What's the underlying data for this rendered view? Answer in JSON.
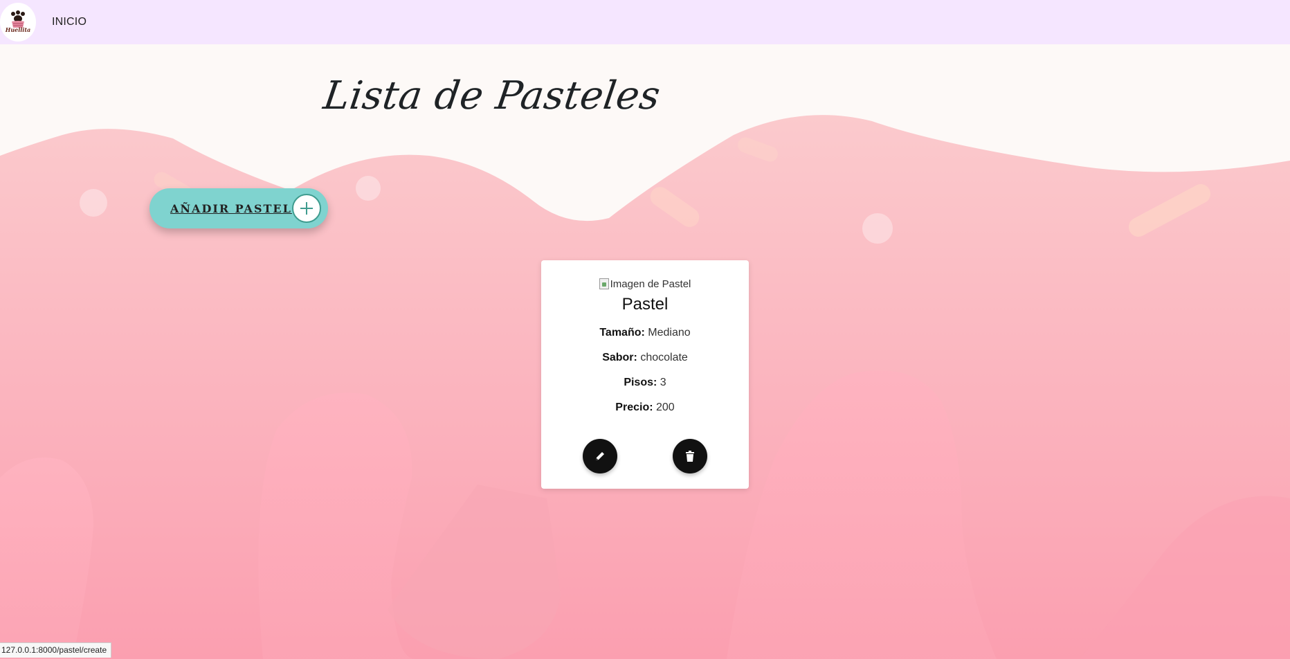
{
  "navbar": {
    "logo_text": "Huellita",
    "links": [
      {
        "label": "INICIO"
      }
    ]
  },
  "main": {
    "title": "Lista de Pasteles",
    "add_button_label": "AÑADIR PASTEL",
    "card": {
      "image_alt": "Imagen de Pastel",
      "title": "Pastel",
      "fields": [
        {
          "label": "Tamaño:",
          "value": "Mediano"
        },
        {
          "label": "Sabor:",
          "value": "chocolate"
        },
        {
          "label": "Pisos:",
          "value": "3"
        },
        {
          "label": "Precio:",
          "value": "200"
        }
      ],
      "actions": [
        {
          "name": "edit",
          "icon": "pencil-icon"
        },
        {
          "name": "delete",
          "icon": "trash-icon"
        }
      ]
    }
  },
  "status_bar": {
    "url": "127.0.0.1:8000/pastel/create"
  },
  "colors": {
    "navbar": "#f5e6ff",
    "button_teal": "#7fd3cf",
    "background_pink": "#fbc9cb",
    "cream": "#fdf9f7"
  }
}
